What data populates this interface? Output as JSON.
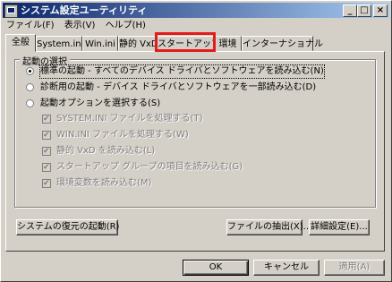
{
  "window": {
    "title": "システム設定ユーティリティ"
  },
  "titlebar_buttons": {
    "minimize": "_",
    "maximize": "□",
    "close": "×"
  },
  "menu": [
    "ファイル(F)",
    "表示(V)",
    "ヘルプ(H)"
  ],
  "tabs": [
    "全般",
    "System.ini",
    "Win.ini",
    "静的 VxD",
    "スタートアップ",
    "環境",
    "インターナショナル"
  ],
  "active_tab": "全般",
  "highlighted_tab": "スタートアップ",
  "highlight_color": "#e31b1b",
  "startup": {
    "group_title": "起動の選択",
    "options": [
      {
        "label": "標準の起動 - すべてのデバイス ドライバとソフトウェアを読み込む(N)",
        "selected": true
      },
      {
        "label": "診断用の起動 - デバイス ドライバとソフトウェアを一部読み込む(D)",
        "selected": false
      },
      {
        "label": "起動オプションを選択する(S)",
        "selected": false
      }
    ],
    "suboptions": [
      {
        "label": "SYSTEM.INI ファイルを処理する(T)",
        "checked": true,
        "enabled": false
      },
      {
        "label": "WIN.INI ファイルを処理する(W)",
        "checked": true,
        "enabled": false
      },
      {
        "label": "静的 VxD を読み込む(L)",
        "checked": true,
        "enabled": false
      },
      {
        "label": "スタートアップ グループの項目を読み込む(G)",
        "checked": true,
        "enabled": false
      },
      {
        "label": "環境変数を読み込む(M)",
        "checked": true,
        "enabled": false
      }
    ]
  },
  "buttons": {
    "restore": "システムの復元の起動(R)",
    "extract": "ファイルの抽出(X)...",
    "advanced": "詳細設定(E)...",
    "ok": "OK",
    "cancel": "キャンセル",
    "apply": "適用(A)"
  }
}
